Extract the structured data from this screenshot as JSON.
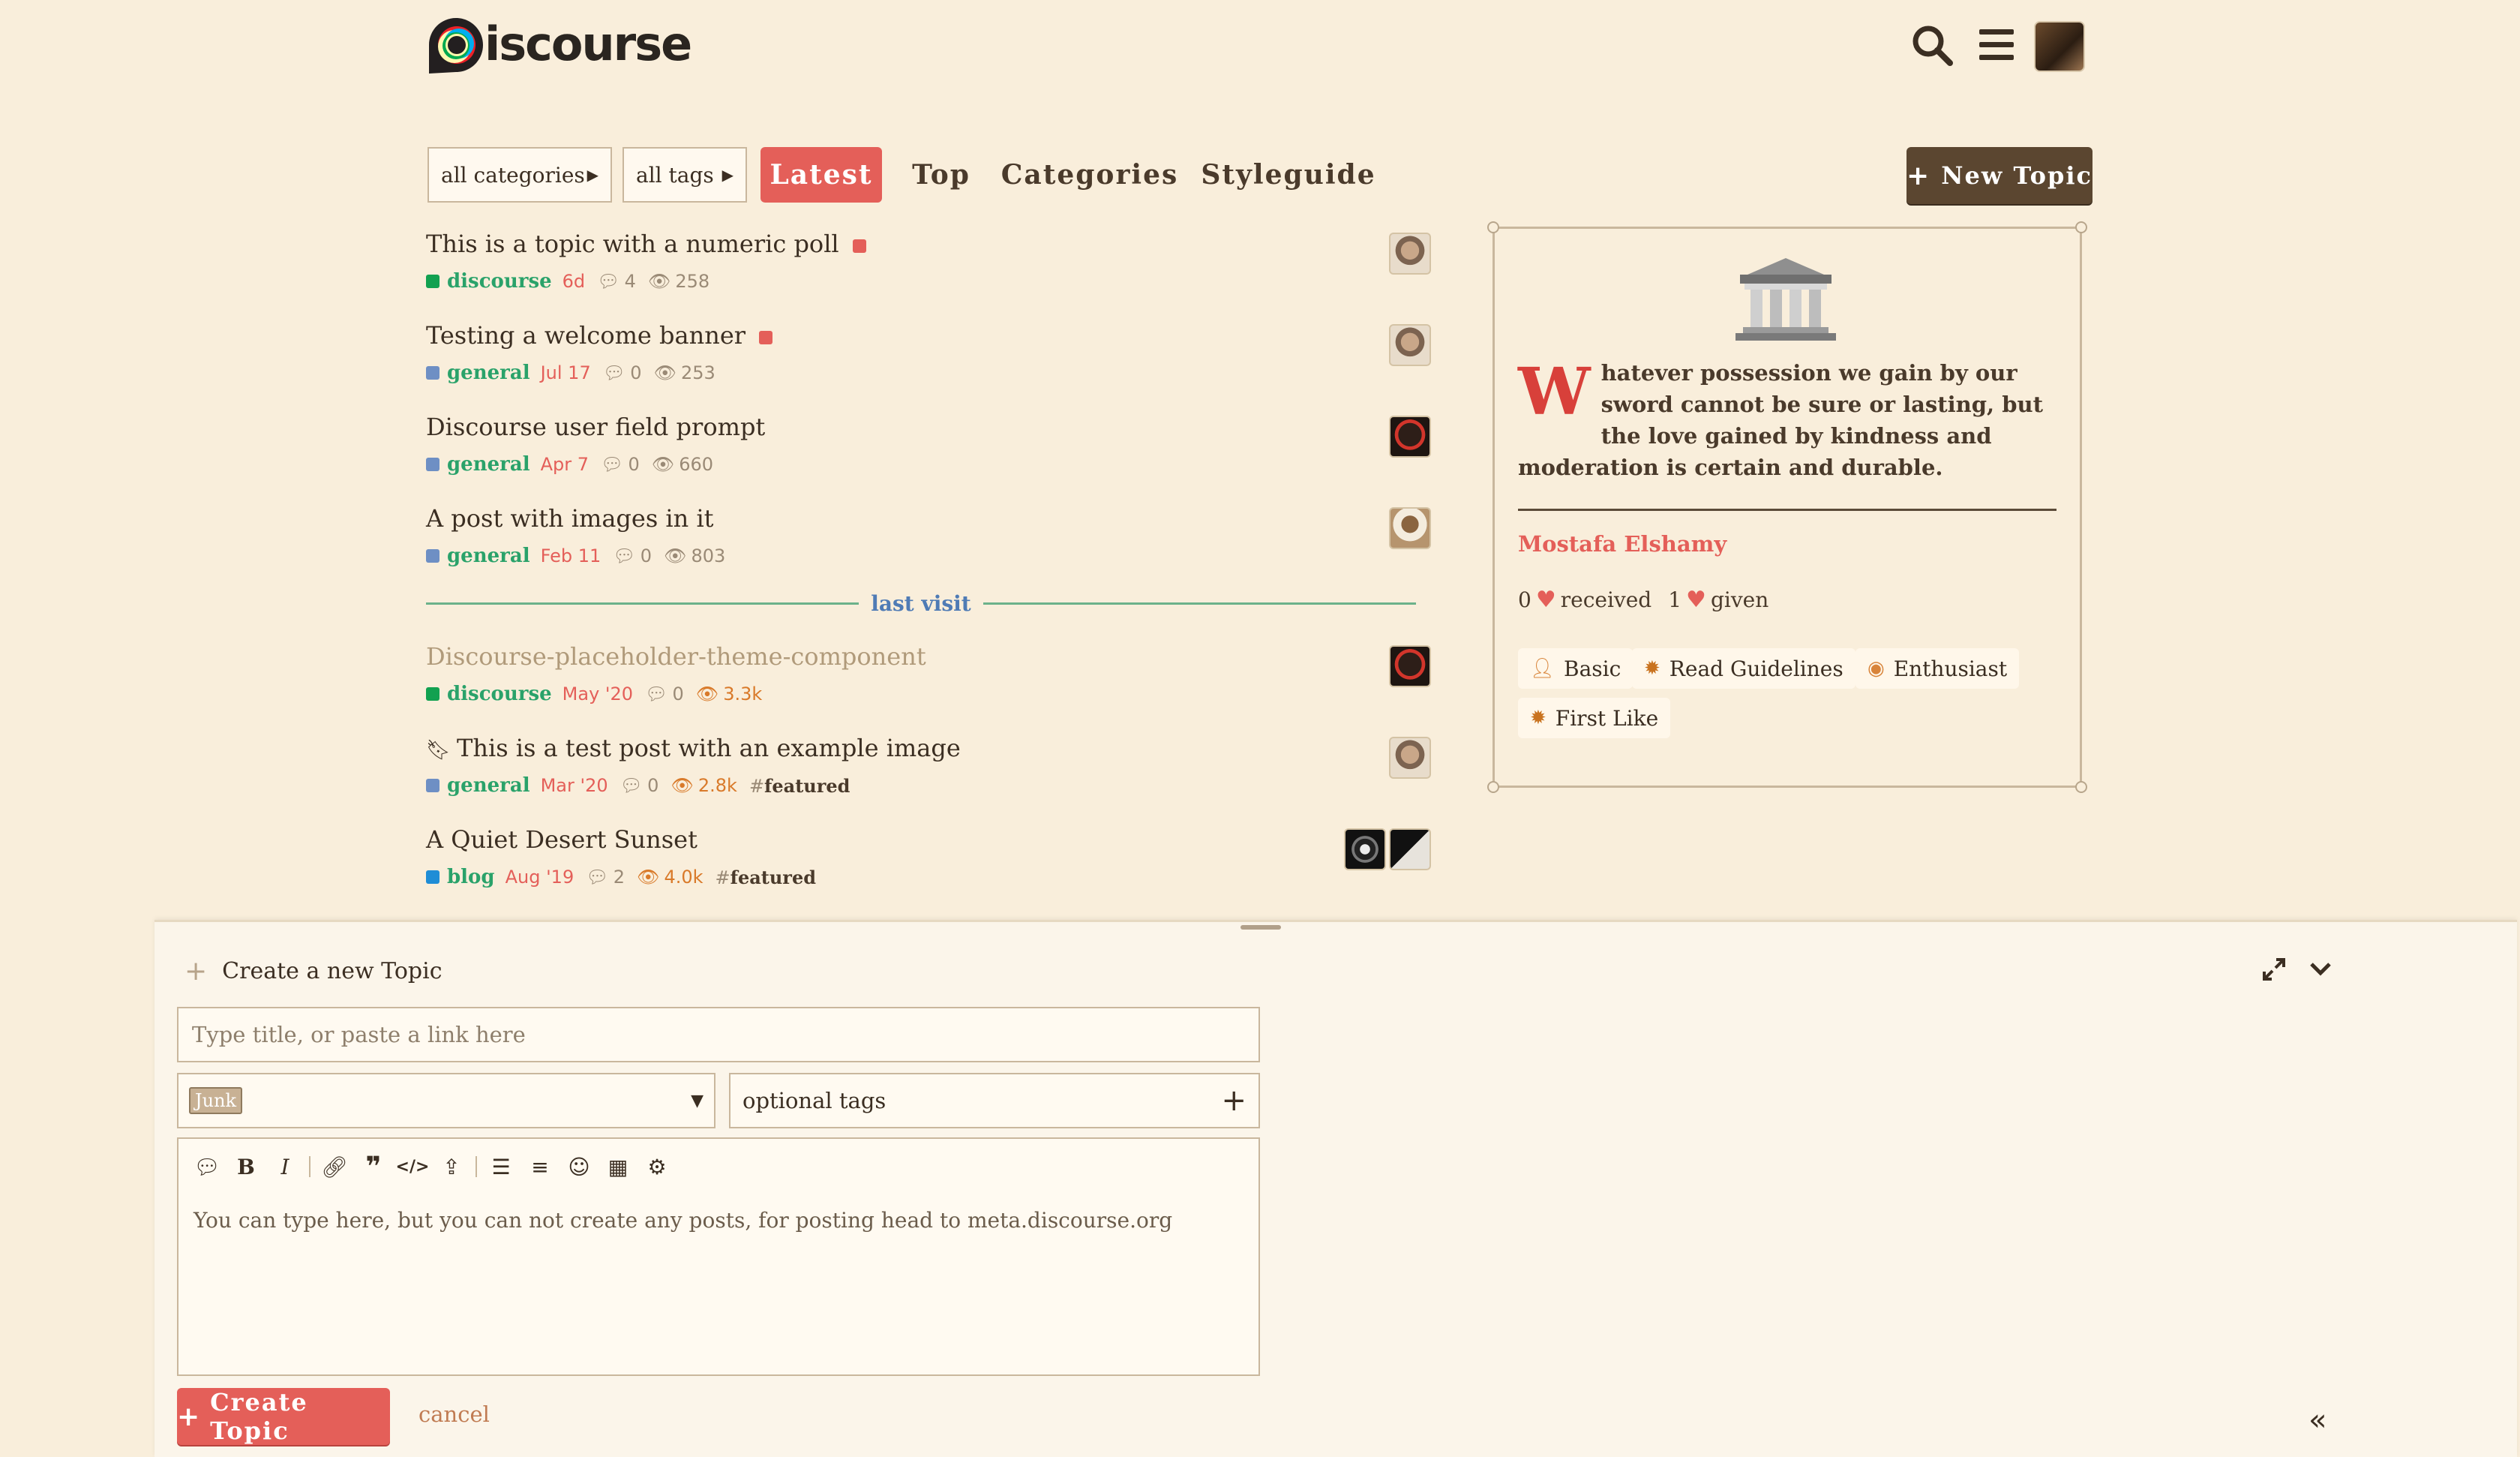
{
  "header": {
    "logo_text": "iscourse",
    "icons": [
      "search-icon",
      "hamburger-menu-icon",
      "user-avatar"
    ]
  },
  "nav": {
    "categories_drop": "all categories",
    "tags_drop": "all tags",
    "tabs": [
      "Latest",
      "Top",
      "Categories",
      "Styleguide"
    ],
    "new_topic": "New Topic"
  },
  "topics": [
    {
      "title": "This is a topic with a numeric poll",
      "category": "discourse",
      "category_color": "#12a150",
      "age": "6d",
      "replies": "4",
      "views": "258",
      "hot": false,
      "tag": ""
    },
    {
      "title": "Testing a welcome banner",
      "category": "general",
      "category_color": "#6e8fc4",
      "age": "Jul 17",
      "replies": "0",
      "views": "253",
      "hot": false,
      "tag": ""
    },
    {
      "title": "Discourse user field prompt",
      "category": "general",
      "category_color": "#6e8fc4",
      "age": "Apr 7",
      "replies": "0",
      "views": "660",
      "hot": false,
      "tag": ""
    },
    {
      "title": "A post with images in it",
      "category": "general",
      "category_color": "#6e8fc4",
      "age": "Feb 11",
      "replies": "0",
      "views": "803",
      "hot": false,
      "tag": ""
    },
    {
      "title": "Discourse-placeholder-theme-component",
      "category": "discourse",
      "category_color": "#12a150",
      "age": "May '20",
      "replies": "0",
      "views": "3.3k",
      "hot": true,
      "tag": ""
    },
    {
      "title": "This is a test post with an example image",
      "category": "general",
      "category_color": "#6e8fc4",
      "age": "Mar '20",
      "replies": "0",
      "views": "2.8k",
      "hot": true,
      "tag": "featured"
    },
    {
      "title": "A Quiet Desert Sunset",
      "category": "blog",
      "category_color": "#1f8dd6",
      "age": "Aug '19",
      "replies": "2",
      "views": "4.0k",
      "hot": true,
      "tag": "featured"
    }
  ],
  "last_visit": "last visit",
  "sidebar": {
    "drop_cap": "W",
    "quote": "hatever possession we gain by our sword cannot be sure or lasting, but the love gained by kindness and moderation is certain and durable.",
    "author": "Mostafa Elshamy",
    "likes_received_count": "0",
    "likes_received_label": "received",
    "likes_given_count": "1",
    "likes_given_label": "given",
    "badges": [
      "Basic",
      "Read Guidelines",
      "Enthusiast",
      "First Like"
    ]
  },
  "composer": {
    "title": "Create a new Topic",
    "title_placeholder": "Type title, or paste a link here",
    "category": "Junk",
    "tags_placeholder": "optional tags",
    "body": "You can type here, but you can not create any posts, for posting head to meta.discourse.org",
    "create_label": "Create Topic",
    "cancel_label": "cancel"
  },
  "colors": {
    "accent": "#e45f59",
    "primary_button": "#5b4630",
    "background": "#f9eedb"
  }
}
